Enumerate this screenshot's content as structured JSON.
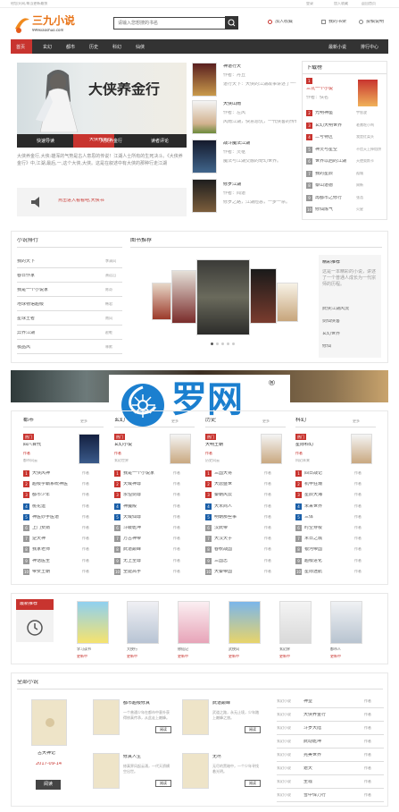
{
  "topbar": {
    "left": "给您头网,每当更新最快",
    "links": [
      "登录",
      "加入收藏",
      "返回首页"
    ]
  },
  "header": {
    "logo_text": "三九小说",
    "logo_sub": "999xiaoshuo.com",
    "search_placeholder": "请输入您想搜的书名",
    "links": [
      "加入收藏",
      "我的书架",
      "投稿说明"
    ]
  },
  "nav": {
    "items": [
      "首页",
      "玄幻",
      "都市",
      "历史",
      "科幻",
      "仙侠"
    ],
    "right": [
      "最新小说",
      "排行中心"
    ]
  },
  "hero": {
    "title": "大侠养金行",
    "tabs": [
      "快速导读",
      "大侠养金行",
      "读者评论"
    ],
    "desc": "大侠养金行,大侠:雄浑的气势是古人意思的传说！江湖人士所有的生死决斗。《大侠养金行》中,江湖,最后,一,这个大侠,大侠。这是在叙述中有大侠的那种行走江湖",
    "notice": "点击进入看看吧,大侠书"
  },
  "mid": {
    "books": [
      {
        "title": "神道行天",
        "meta": "作者：丹丘",
        "desc": "道行天下：大侠的江湖故事讲述了一个侠客的成长。"
      },
      {
        "title": "大侠山雨",
        "meta": "作者：左风",
        "desc": "风雨江湖，快意恩仇，一代侠客的传奇故事。"
      },
      {
        "title": "战斗魔法江湖",
        "meta": "作者：灵枢",
        "desc": "魔法与江湖交融的奇幻世界。"
      },
      {
        "title": "修罗江湖",
        "meta": "作者：闻道",
        "desc": "修罗之路，江湖险恶，一步一杀。"
      }
    ]
  },
  "rank": {
    "title": "下载榜",
    "top": {
      "title": "三坑一个小说",
      "author": "作者：佚名"
    },
    "items": [
      {
        "name": "光明神座",
        "author": "宇智波"
      },
      {
        "name": "玄幻大明世界",
        "author": "老鹰吃小鸡"
      },
      {
        "name": "二号特区",
        "author": "我是红菜头"
      },
      {
        "name": "神灵与星空",
        "author": "不信天上掉馅饼"
      },
      {
        "name": "世界以后的江湖",
        "author": "天使奥斯卡"
      },
      {
        "name": "我的星辰",
        "author": "孤城"
      },
      {
        "name": "泰山道德",
        "author": "周新"
      },
      {
        "name": "再都市之修行",
        "author": "张浩"
      },
      {
        "name": "修仙炼气",
        "author": "火星"
      }
    ]
  },
  "left2": {
    "title": "小说排行",
    "items": [
      {
        "n": "我的天下",
        "a": "李清风"
      },
      {
        "n": "春日作家",
        "a": "萧远山"
      },
      {
        "n": "我是一个小说家",
        "a": "陈奇"
      },
      {
        "n": "地球物语超级",
        "a": "韩君"
      },
      {
        "n": "星球王者",
        "a": "南风"
      },
      {
        "n": "异界江湖",
        "a": "赵乾"
      },
      {
        "n": "极品风",
        "a": "林默"
      }
    ]
  },
  "showcase": {
    "title": "图书推荐",
    "side_title": "精彩推荐",
    "side_desc": "这是一本精彩的小说，讲述了一个普通人成长为一代宗师的历程。",
    "side_links": [
      "武侠江湖风流",
      "剑仙侠客",
      "玄幻世界",
      "修仙"
    ]
  },
  "cols": [
    {
      "title": "都市",
      "more": "更多",
      "top": {
        "badge": "热门",
        "name": "四八百代",
        "meta": "作者",
        "desc": "都市风云"
      },
      "items": [
        "大侠风神",
        "超级学霸系统神医",
        "都市少年",
        "桃花运",
        "神医妙手医道",
        "上门女婿",
        "逆天神",
        "我家老师",
        "神话医圣",
        "帝女王朝"
      ]
    },
    {
      "title": "玄幻",
      "more": "更多",
      "top": {
        "badge": "热门",
        "name": "玄幻小说",
        "meta": "作者",
        "desc": "玄幻世界"
      },
      "items": [
        "我是一个小说家",
        "天域神尊",
        "永恒剑尊",
        "神魔殿",
        "天域仙尊",
        "斗破乾坤",
        "万古神帝",
        "武道巅峰",
        "无上至尊",
        "全能高手"
      ]
    },
    {
      "title": "历史",
      "more": "更多",
      "top": {
        "badge": "热门",
        "name": "大明王朝",
        "meta": "作者",
        "desc": "历史风云"
      },
      "items": [
        "三国大将",
        "大唐盛世",
        "秦朝风云",
        "大宋商人",
        "明朝那些事",
        "汉武帝",
        "大汉天子",
        "春秋战国",
        "三国志",
        "大秦帝国"
      ]
    },
    {
      "title": "科幻",
      "more": "更多",
      "top": {
        "badge": "热门",
        "name": "星际科幻",
        "meta": "作者",
        "desc": "科幻未来"
      },
      "items": [
        "四日战记",
        "机甲狂潮",
        "星辰大海",
        "未来世界",
        "三体",
        "时空穿梭",
        "末日之城",
        "银河帝国",
        "超级进化",
        "星际迷航"
      ]
    }
  ],
  "promo": {
    "title": "最新推荐",
    "books": [
      {
        "name": "学习读书",
        "tag": "更新中"
      },
      {
        "name": "大侠行",
        "tag": "更新中"
      },
      {
        "name": "修仙记",
        "tag": "更新中"
      },
      {
        "name": "武侠风",
        "tag": "更新中"
      },
      {
        "name": "玄幻界",
        "tag": "更新中"
      },
      {
        "name": "都市人",
        "tag": "更新中"
      }
    ]
  },
  "bottom": {
    "title": "全部小说",
    "featured": {
      "name": "古大神记",
      "date": "2017-09-14",
      "btn": "阅读"
    },
    "books": [
      {
        "name": "都市超级修真",
        "desc": "一个普通少年在都市中意外获得修真传承，从此走上巅峰。",
        "btn": "阅读"
      },
      {
        "name": "武道巅峰",
        "desc": "武道之路，永无止境，少年踏上巅峰之旅。",
        "btn": "阅读"
      },
      {
        "name": "修真人生",
        "desc": "修真界风起云涌，一代天骄横空出世。",
        "btn": "阅读"
      },
      {
        "name": "无尽",
        "desc": "无尽的黑暗中，一个少年寻找着光明。",
        "btn": "阅读"
      }
    ],
    "list": [
      {
        "c": "玄幻小说",
        "n": "神皇",
        "a": "作者"
      },
      {
        "c": "玄幻小说",
        "n": "大侠养金行",
        "a": "作者"
      },
      {
        "c": "玄幻小说",
        "n": "斗罗大陆",
        "a": "作者"
      },
      {
        "c": "玄幻小说",
        "n": "武动乾坤",
        "a": "作者"
      },
      {
        "c": "玄幻小说",
        "n": "完美世界",
        "a": "作者"
      },
      {
        "c": "玄幻小说",
        "n": "遮天",
        "a": "作者"
      },
      {
        "c": "玄幻小说",
        "n": "圣墟",
        "a": "作者"
      },
      {
        "c": "玄幻小说",
        "n": "雪中悍刀行",
        "a": "作者"
      }
    ]
  },
  "watermark": {
    "text": "罗网",
    "reg": "®"
  },
  "colors": {
    "accent": "#c8342f",
    "nav": "#333333",
    "blue": "#1b7fcf"
  }
}
